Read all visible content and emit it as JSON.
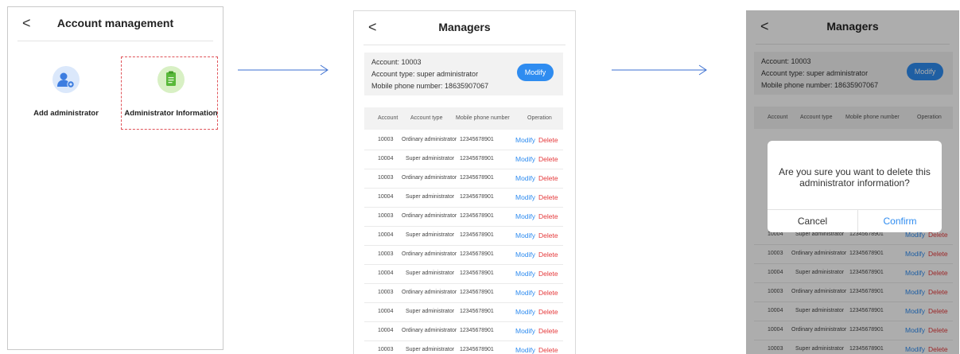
{
  "screen1": {
    "back": "<",
    "title": "Account management",
    "tiles": [
      {
        "label": "Add administrator",
        "icon": "user-settings-icon"
      },
      {
        "label": "Administrator Information",
        "icon": "clipboard-icon"
      }
    ]
  },
  "screen2": {
    "back": "<",
    "title": "Managers",
    "info": {
      "account": "Account: 10003",
      "type": "Account type: super administrator",
      "phone": "Mobile phone number: 18635907067",
      "modify": "Modify"
    },
    "headers": [
      "Account",
      "Account type",
      "Mobile phone number",
      "Operation"
    ],
    "rows": [
      {
        "account": "10003",
        "type": "Ordinary administrator",
        "phone": "12345678901"
      },
      {
        "account": "10004",
        "type": "Super administrator",
        "phone": "12345678901"
      },
      {
        "account": "10003",
        "type": "Ordinary administrator",
        "phone": "12345678901"
      },
      {
        "account": "10004",
        "type": "Super administrator",
        "phone": "12345678901"
      },
      {
        "account": "10003",
        "type": "Ordinary administrator",
        "phone": "12345678901"
      },
      {
        "account": "10004",
        "type": "Super administrator",
        "phone": "12345678901"
      },
      {
        "account": "10003",
        "type": "Ordinary administrator",
        "phone": "12345678901"
      },
      {
        "account": "10004",
        "type": "Super administrator",
        "phone": "12345678901"
      },
      {
        "account": "10003",
        "type": "Ordinary administrator",
        "phone": "12345678901"
      },
      {
        "account": "10004",
        "type": "Super administrator",
        "phone": "12345678901"
      },
      {
        "account": "10004",
        "type": "Ordinary administrator",
        "phone": "12345678901"
      },
      {
        "account": "10003",
        "type": "Super administrator",
        "phone": "12345678901"
      }
    ],
    "modify": "Modify",
    "delete": "Delete"
  },
  "screen3": {
    "back": "<",
    "title": "Managers",
    "visible_rows": [
      {
        "account": "10004",
        "type": "Super administrator",
        "phone": "12345678901"
      },
      {
        "account": "10003",
        "type": "Ordinary administrator",
        "phone": "12345678901"
      },
      {
        "account": "10004",
        "type": "Super administrator",
        "phone": "12345678901"
      },
      {
        "account": "10003",
        "type": "Ordinary administrator",
        "phone": "12345678901"
      },
      {
        "account": "10004",
        "type": "Super administrator",
        "phone": "12345678901"
      },
      {
        "account": "10004",
        "type": "Ordinary administrator",
        "phone": "12345678901"
      },
      {
        "account": "10003",
        "type": "Super administrator",
        "phone": "12345678901"
      }
    ],
    "dialog": {
      "message": "Are you sure you want to delete this administrator information?",
      "cancel": "Cancel",
      "confirm": "Confirm"
    }
  },
  "colors": {
    "accent": "#2f8cf0",
    "danger": "#e5393b",
    "highlight": "#e0545a"
  }
}
